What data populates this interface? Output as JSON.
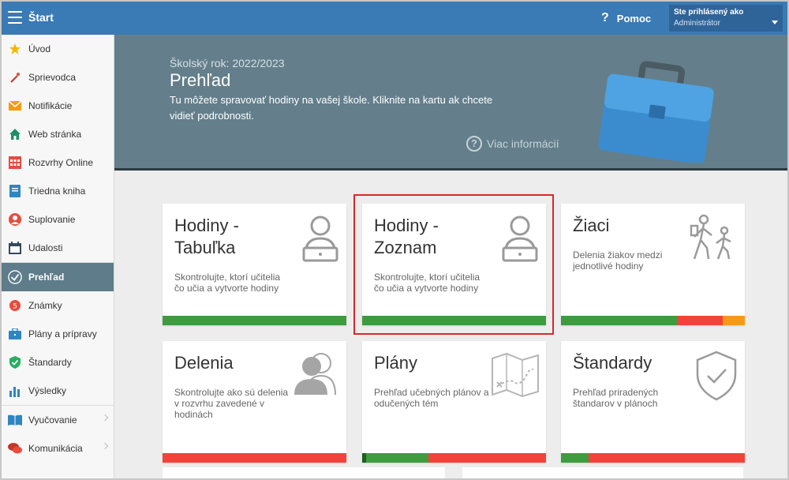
{
  "app": {
    "brand": "Štart",
    "help_label": "Pomoc",
    "account_line1": "Ste prihlásený ako",
    "account_line2": "Administrátor"
  },
  "sidebar": {
    "items": [
      {
        "label": "Úvod",
        "icon": "star-icon"
      },
      {
        "label": "Sprievodca",
        "icon": "magic-wand-icon"
      },
      {
        "label": "Notifikácie",
        "icon": "envelope-icon"
      },
      {
        "label": "Web stránka",
        "icon": "house-icon"
      },
      {
        "label": "Rozvrhy Online",
        "icon": "calendar-grid-icon"
      },
      {
        "label": "Triedna kniha",
        "icon": "notebook-icon"
      },
      {
        "label": "Suplovanie",
        "icon": "person-icon"
      },
      {
        "label": "Udalosti",
        "icon": "calendar-icon"
      },
      {
        "label": "Prehľad",
        "icon": "check-circle-icon"
      },
      {
        "label": "Známky",
        "icon": "grade-icon"
      },
      {
        "label": "Plány a prípravy",
        "icon": "briefcase-icon"
      },
      {
        "label": "Štandardy",
        "icon": "shield-check-icon"
      },
      {
        "label": "Výsledky",
        "icon": "bar-chart-icon"
      },
      {
        "label": "Vyučovanie",
        "icon": "book-icon"
      },
      {
        "label": "Komunikácia",
        "icon": "chat-icon"
      }
    ]
  },
  "hero": {
    "year": "Školský rok: 2022/2023",
    "title": "Prehľad",
    "desc": "Tu môžete spravovať hodiny na vašej škole. Kliknite na kartu ak chcete vidieť podrobnosti.",
    "more": "Viac informácií"
  },
  "cards": [
    {
      "title": "Hodiny - Tabuľka",
      "desc": "Skontrolujte, ktorí učitelia čo učia a vytvorte hodiny",
      "icon": "teacher-laptop-icon",
      "progress": [
        {
          "color": "#3e9b3e",
          "fraction": 1.0
        }
      ]
    },
    {
      "title": "Hodiny - Zoznam",
      "desc": "Skontrolujte, ktorí učitelia čo učia a vytvorte hodiny",
      "icon": "teacher-laptop-icon",
      "progress": [
        {
          "color": "#3e9b3e",
          "fraction": 1.0
        }
      ]
    },
    {
      "title": "Žiaci",
      "desc": "Delenia žiakov medzi jednotlivé hodiny",
      "icon": "walking-people-icon",
      "progress": [
        {
          "color": "#3e9b3e",
          "fraction": 0.63
        },
        {
          "color": "#f2433a",
          "fraction": 0.25
        },
        {
          "color": "#f39a1b",
          "fraction": 0.12
        }
      ]
    },
    {
      "title": "Delenia",
      "desc": "Skontrolujte ako sú delenia v rozvrhu zavedené v hodinách",
      "icon": "two-people-icon",
      "progress": [
        {
          "color": "#f2433a",
          "fraction": 1.0
        }
      ]
    },
    {
      "title": "Plány",
      "desc": "Prehľad učebných plánov a odučených tém",
      "icon": "map-icon",
      "progress": [
        {
          "color": "#1e5e1e",
          "fraction": 0.02
        },
        {
          "color": "#3e9b3e",
          "fraction": 0.34
        },
        {
          "color": "#f2433a",
          "fraction": 0.64
        }
      ]
    },
    {
      "title": "Štandardy",
      "desc": "Prehľad priradených štandarov v plánoch",
      "icon": "shield-check-icon",
      "progress": [
        {
          "color": "#3e9b3e",
          "fraction": 0.15
        },
        {
          "color": "#f2433a",
          "fraction": 0.85
        }
      ]
    }
  ]
}
